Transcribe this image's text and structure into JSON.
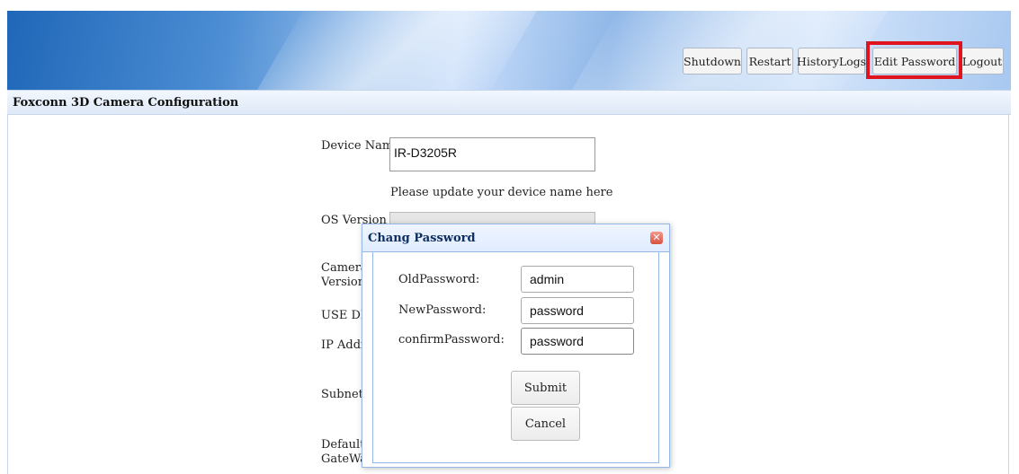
{
  "toolbar": {
    "shutdown": "Shutdown",
    "restart": "Restart",
    "history_logs": "HistoryLogs",
    "edit_password": "Edit Password",
    "logout": "Logout"
  },
  "page_title": "Foxconn 3D Camera Configuration",
  "form": {
    "device_name_label": "Device Name",
    "device_name_value": "IR-D3205R",
    "device_name_hint": "Please update your device name here",
    "os_version_label": "OS Version",
    "camera_version_label_1": "Camera",
    "camera_version_label_2": "Version",
    "use_dhcp_label": "USE DH",
    "ip_address_label": "IP Addre",
    "subnet_label": "Subnet N",
    "default_gateway_label_1": "Default",
    "default_gateway_label_2": "GateWay"
  },
  "dialog": {
    "title": "Chang Password",
    "old_label": "OldPassword:",
    "old_value": "admin",
    "new_label": "NewPassword:",
    "new_value": "password",
    "confirm_label": "confirmPassword:",
    "confirm_value": "password",
    "submit": "Submit",
    "cancel": "Cancel"
  },
  "colors": {
    "highlight": "#e0141f",
    "dialog_border": "#95b8e7"
  }
}
